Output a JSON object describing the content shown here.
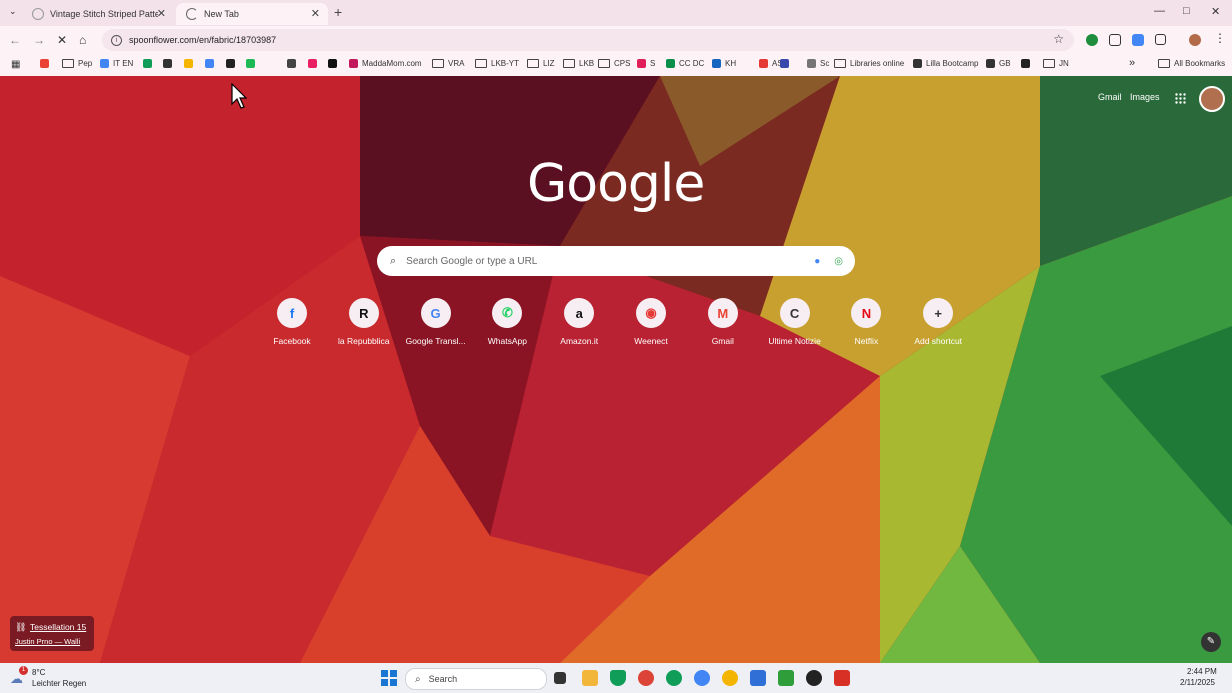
{
  "tabs": [
    {
      "title": "Vintage Stitch Striped Pattern E",
      "active": false
    },
    {
      "title": "New Tab",
      "active": true
    }
  ],
  "window_controls": {
    "minimize": "—",
    "maximize": "□",
    "close": "✕"
  },
  "address_bar": {
    "url": "spoonflower.com/en/fabric/18703987"
  },
  "bookmarks": [
    {
      "label": "",
      "icon": "gmail-icon",
      "color": "#ea4335"
    },
    {
      "label": "Pep",
      "icon": "folder-icon"
    },
    {
      "label": "IT EN",
      "icon": "translate-icon",
      "color": "#4285f4"
    },
    {
      "label": "",
      "icon": "drive-icon",
      "color": "#0f9d58"
    },
    {
      "label": "",
      "icon": "square-icon",
      "color": "#333333"
    },
    {
      "label": "",
      "icon": "circle-icon",
      "color": "#f4b400"
    },
    {
      "label": "",
      "icon": "translate-icon",
      "color": "#4285f4"
    },
    {
      "label": "",
      "icon": "hex-icon",
      "color": "#222222"
    },
    {
      "label": "",
      "icon": "spark-icon",
      "color": "#1db954"
    },
    {
      "label": "",
      "icon": "amp-icon",
      "color": "#444444"
    },
    {
      "label": "",
      "icon": "dots-icon",
      "color": "#e91e63"
    },
    {
      "label": "",
      "icon": "disc-icon",
      "color": "#111111"
    },
    {
      "label": "MaddaMom.com",
      "icon": "maddamom-icon",
      "color": "#c2185b"
    },
    {
      "label": "VRA",
      "icon": "folder-icon"
    },
    {
      "label": "LKB-YT",
      "icon": "folder-icon"
    },
    {
      "label": "LIZ",
      "icon": "folder-icon"
    },
    {
      "label": "LKB",
      "icon": "folder-icon"
    },
    {
      "label": "CPS",
      "icon": "folder-icon"
    },
    {
      "label": "S",
      "icon": "slack-icon",
      "color": "#e01e5a"
    },
    {
      "label": "CC DC",
      "icon": "cc-icon",
      "color": "#0a8f4a"
    },
    {
      "label": "KH",
      "icon": "kh-icon",
      "color": "#1565c0"
    },
    {
      "label": "AS",
      "icon": "as-icon",
      "color": "#e53935"
    },
    {
      "label": "",
      "icon": "bolt-icon",
      "color": "#3949ab"
    },
    {
      "label": "Sc",
      "icon": "sc-icon",
      "color": "#757575"
    },
    {
      "label": "Libraries online",
      "icon": "folder-icon"
    },
    {
      "label": "Lilla Bootcamp",
      "icon": "globe-icon",
      "color": "#333333"
    },
    {
      "label": "GB",
      "icon": "gb-icon",
      "color": "#333333"
    },
    {
      "label": "",
      "icon": "star-icon",
      "color": "#222222"
    },
    {
      "label": "JN",
      "icon": "folder-icon"
    }
  ],
  "all_bookmarks_label": "All Bookmarks",
  "more_bookmarks": "»",
  "ntp": {
    "gmail_link": "Gmail",
    "images_link": "Images",
    "logo": "Google",
    "search_placeholder": "Search Google or type a URL",
    "shortcuts": [
      {
        "label": "Facebook",
        "glyph": "f",
        "icon": "facebook-icon",
        "color": "#1877f2"
      },
      {
        "label": "la Repubblica",
        "glyph": "R",
        "icon": "repubblica-icon",
        "color": "#111111"
      },
      {
        "label": "Google Transl...",
        "glyph": "G",
        "icon": "google-translate-icon",
        "color": "#4285f4"
      },
      {
        "label": "WhatsApp",
        "glyph": "✆",
        "icon": "whatsapp-icon",
        "color": "#25d366"
      },
      {
        "label": "Amazon.it",
        "glyph": "a",
        "icon": "amazon-icon",
        "color": "#111111"
      },
      {
        "label": "Weenect",
        "glyph": "◉",
        "icon": "weenect-icon",
        "color": "#e53935"
      },
      {
        "label": "Gmail",
        "glyph": "M",
        "icon": "gmail-icon",
        "color": "#ea4335"
      },
      {
        "label": "Ultime Notizie",
        "glyph": "C",
        "icon": "ultime-notizie-icon",
        "color": "#333333"
      },
      {
        "label": "Netflix",
        "glyph": "N",
        "icon": "netflix-icon",
        "color": "#e50914"
      },
      {
        "label": "Add shortcut",
        "glyph": "+",
        "icon": "plus-icon",
        "color": "#333333"
      }
    ],
    "background_credit": {
      "title": "Tessellation 15",
      "author": "Justin Prno — Walli"
    }
  },
  "taskbar": {
    "weather": {
      "temp": "8°C",
      "condition": "Leichter Regen",
      "badge": "1"
    },
    "search_label": "Search",
    "time": "2:44 PM",
    "date": "2/11/2025"
  }
}
